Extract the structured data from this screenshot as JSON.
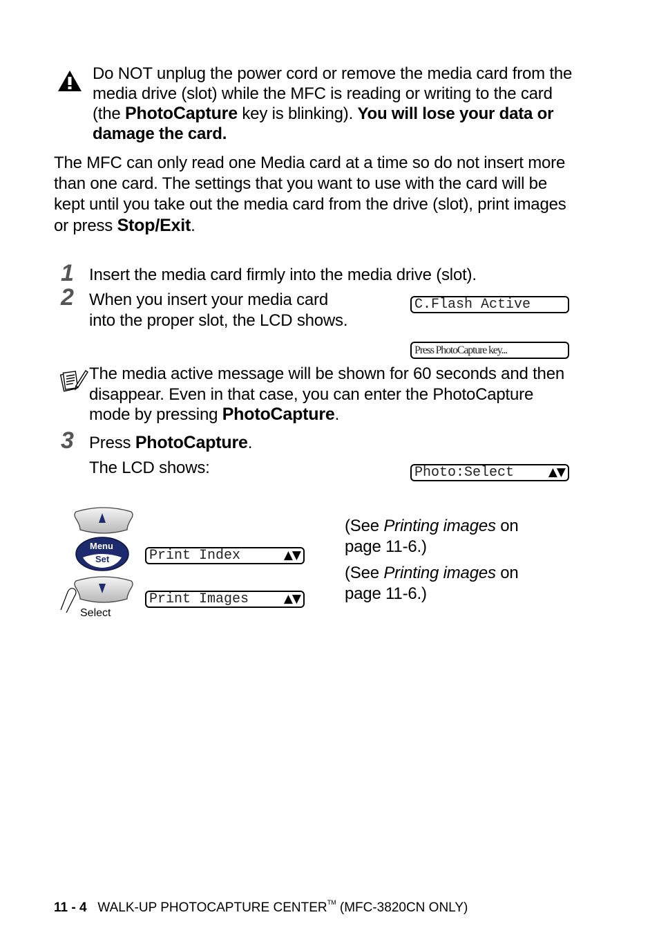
{
  "warning": {
    "icon": "warning-triangle-icon",
    "text_1": "Do NOT unplug the power cord or remove the media card from the media drive (slot) while the MFC is reading or writing to the card (the ",
    "key_name": "PhotoCapture",
    "text_2": " key is blinking). ",
    "bold_text": "You will lose your data or damage the card."
  },
  "intro": {
    "text": "The MFC can only read one Media card at a time so do not insert more than one card. The settings that you want to use with the card will be kept until you take out the media card from the drive (slot), print images or press ",
    "key_name": "Stop/Exit",
    "end": "."
  },
  "steps": [
    {
      "number": "1",
      "text": "Insert the media card firmly into the media drive (slot)."
    },
    {
      "number": "2",
      "text_line1": "When you insert your media card",
      "text_line2": "into the proper slot, the LCD shows.",
      "lcd": [
        "C.Flash Active",
        "Press PhotoCapture key..."
      ]
    },
    {
      "number": "3",
      "prefix": "Press ",
      "key_name": "PhotoCapture",
      "end": ".",
      "sub": "The LCD shows:",
      "lcd": "Photo:Select",
      "lcd_arrows": "▲▼"
    }
  ],
  "note": {
    "icon": "note-pad-icon",
    "text": "The media active message will be shown for 60 seconds and then disappear. Even in that case, you can enter the PhotoCapture mode by pressing ",
    "key_name": "PhotoCapture",
    "end": "."
  },
  "menu_diagram": {
    "up_key": "▲",
    "menu_label": "Menu",
    "set_label": "Set",
    "down_key": "▼",
    "select_label": "Select",
    "options": [
      {
        "lcd": "Print Index",
        "arrows": "▲▼",
        "ref_prefix": "(See ",
        "ref_italic": "Printing images",
        "ref_suffix": " on page 11-6.)"
      },
      {
        "lcd": "Print Images",
        "arrows": "▲▼",
        "ref_prefix": "(See ",
        "ref_italic": "Printing images",
        "ref_suffix": " on page 11-6.)"
      }
    ]
  },
  "footer": {
    "page": "11 - 4",
    "chapter": "WALK-UP PHOTOCAPTURE CENTER",
    "tm": "TM",
    "model": "(MFC-3820CN ONLY)"
  }
}
